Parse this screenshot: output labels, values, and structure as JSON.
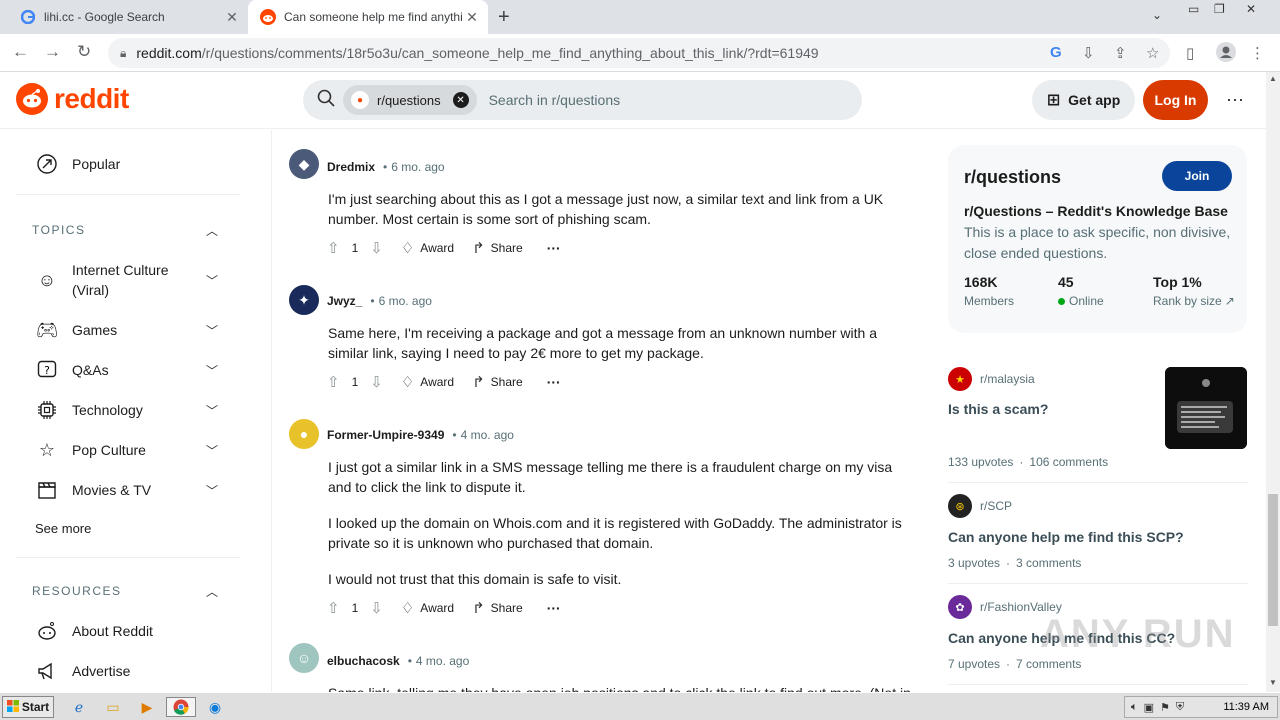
{
  "browser": {
    "tabs": [
      {
        "title": "lihi.cc - Google Search",
        "active": false
      },
      {
        "title": "Can someone help me find anything",
        "active": true
      }
    ],
    "url_host": "reddit.com",
    "url_path": "/r/questions/comments/18r5o3u/can_someone_help_me_find_anything_about_this_link/?rdt=61949"
  },
  "header": {
    "logo_text": "reddit",
    "search_chip": "r/questions",
    "search_placeholder": "Search in r/questions",
    "get_app": "Get app",
    "login": "Log In"
  },
  "leftnav": {
    "popular": "Popular",
    "topics_heading": "TOPICS",
    "topics": [
      {
        "label": "Internet Culture (Viral)",
        "icon": "smile-icon"
      },
      {
        "label": "Games",
        "icon": "gamepad-icon"
      },
      {
        "label": "Q&As",
        "icon": "question-icon"
      },
      {
        "label": "Technology",
        "icon": "chip-icon"
      },
      {
        "label": "Pop Culture",
        "icon": "star-icon"
      },
      {
        "label": "Movies & TV",
        "icon": "clapper-icon"
      }
    ],
    "see_more": "See more",
    "resources_heading": "RESOURCES",
    "resources": [
      {
        "label": "About Reddit",
        "icon": "reddit-icon"
      },
      {
        "label": "Advertise",
        "icon": "megaphone-icon"
      }
    ]
  },
  "comments": [
    {
      "author": "Dredmix",
      "time": "6 mo. ago",
      "avatar_color": "#4a5a78",
      "paragraphs": [
        "I'm just searching about this as I got a message just now, a similar text and link from a UK number. Most certain is some sort of phishing scam."
      ],
      "score": "1"
    },
    {
      "author": "Jwyz_",
      "time": "6 mo. ago",
      "avatar_color": "#1a2a5a",
      "paragraphs": [
        "Same here, I'm receiving a package and got a message from an unknown number with a similar link, saying I need to pay 2€ more to get my package."
      ],
      "score": "1"
    },
    {
      "author": "Former-Umpire-9349",
      "time": "4 mo. ago",
      "avatar_color": "#e8c22a",
      "paragraphs": [
        "I just got a similar link in a SMS message telling me there is a fraudulent charge on my visa and to click the link to dispute it.",
        "I looked up the domain on Whois.com and it is registered with GoDaddy. The administrator is private so it is unknown who purchased that domain.",
        "I would not trust that this domain is safe to visit."
      ],
      "score": "1"
    },
    {
      "author": "elbuchacosk",
      "time": "4 mo. ago",
      "avatar_color": "#9fc5c0",
      "paragraphs": [
        "Same link, telling me they have open job positions and to click the link to find out more. (Not in"
      ],
      "score": ""
    }
  ],
  "actions": {
    "award": "Award",
    "share": "Share",
    "more": "···"
  },
  "subreddit": {
    "name": "r/questions",
    "join": "Join",
    "title": "r/Questions – Reddit's Knowledge Base",
    "description": "This is a place to ask specific, non divisive, close ended questions.",
    "stats": [
      {
        "value": "168K",
        "label": "Members"
      },
      {
        "value": "45",
        "label": "Online"
      },
      {
        "value": "Top 1%",
        "label": "Rank by size"
      }
    ]
  },
  "related": [
    {
      "sub": "r/malaysia",
      "title": "Is this a scam?",
      "upvotes": "133 upvotes",
      "comments": "106 comments",
      "avatar_color": "#cc0000"
    },
    {
      "sub": "r/SCP",
      "title": "Can anyone help me find this SCP?",
      "upvotes": "3 upvotes",
      "comments": "3 comments",
      "avatar_color": "#222222"
    },
    {
      "sub": "r/FashionValley",
      "title": "Can anyone help me find this CC?",
      "upvotes": "7 upvotes",
      "comments": "7 comments",
      "avatar_color": "#6a2a9a"
    }
  ],
  "watermark": "ANY RUN",
  "taskbar": {
    "start": "Start",
    "clock": "11:39 AM"
  }
}
